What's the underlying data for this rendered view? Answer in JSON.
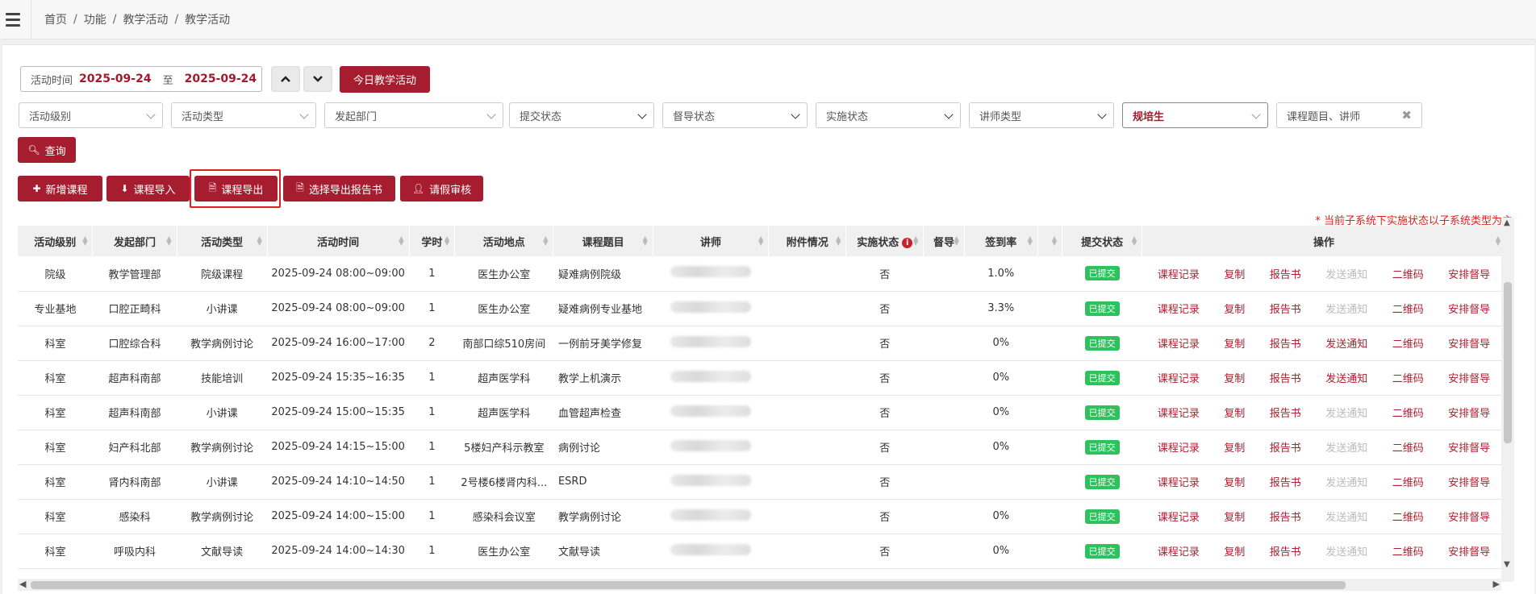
{
  "breadcrumb": [
    "首页",
    "功能",
    "教学活动",
    "教学活动"
  ],
  "date_filter": {
    "label": "活动时间",
    "start": "2025-09-24",
    "to": "至",
    "end": "2025-09-24"
  },
  "today_button": "今日教学活动",
  "filters": [
    {
      "label": "活动级别",
      "style": "light"
    },
    {
      "label": "活动类型",
      "style": "light"
    },
    {
      "label": "发起部门",
      "style": "light"
    },
    {
      "label": "提交状态",
      "style": "dark"
    },
    {
      "label": "督导状态",
      "style": "dark"
    },
    {
      "label": "实施状态",
      "style": "dark"
    },
    {
      "label": "讲师类型",
      "style": "dark"
    },
    {
      "label": "规培生",
      "style": "red"
    }
  ],
  "search_placeholder": "课程题目、讲师",
  "query_button": "查询",
  "actions": {
    "add": "新增课程",
    "import": "课程导入",
    "export": "课程导出",
    "export_report": "选择导出报告书",
    "leave": "请假审核"
  },
  "notice": "* 当前子系统下实施状态以子系统类型为主",
  "columns": [
    "活动级别",
    "发起部门",
    "活动类型",
    "活动时间",
    "学时",
    "活动地点",
    "课程题目",
    "讲师",
    "附件情况",
    "实施状态",
    "督导",
    "签到率",
    "",
    "提交状态",
    "操作"
  ],
  "rows": [
    {
      "level": "院级",
      "dept": "教学管理部",
      "type": "院级课程",
      "time": "2025-09-24  08:00~09:00",
      "hours": "1",
      "place": "医生办公室",
      "topic": "疑难病例院级",
      "impl": "否",
      "rate": "1.0%",
      "status": "已提交",
      "notify_active": false
    },
    {
      "level": "专业基地",
      "dept": "口腔正畸科",
      "type": "小讲课",
      "time": "2025-09-24  08:00~09:00",
      "hours": "1",
      "place": "医生办公室",
      "topic": "疑难病例专业基地",
      "impl": "否",
      "rate": "3.3%",
      "status": "已提交",
      "notify_active": false
    },
    {
      "level": "科室",
      "dept": "口腔综合科",
      "type": "教学病例讨论",
      "time": "2025-09-24  16:00~17:00",
      "hours": "2",
      "place": "南部口综510房间",
      "topic": "一例前牙美学修复",
      "impl": "否",
      "rate": "0%",
      "status": "已提交",
      "notify_active": true
    },
    {
      "level": "科室",
      "dept": "超声科南部",
      "type": "技能培训",
      "time": "2025-09-24  15:35~16:35",
      "hours": "1",
      "place": "超声医学科",
      "topic": "教学上机演示",
      "impl": "否",
      "rate": "0%",
      "status": "已提交",
      "notify_active": true
    },
    {
      "level": "科室",
      "dept": "超声科南部",
      "type": "小讲课",
      "time": "2025-09-24  15:00~15:35",
      "hours": "1",
      "place": "超声医学科",
      "topic": "血管超声检查",
      "impl": "否",
      "rate": "0%",
      "status": "已提交",
      "notify_active": false
    },
    {
      "level": "科室",
      "dept": "妇产科北部",
      "type": "教学病例讨论",
      "time": "2025-09-24  14:15~15:00",
      "hours": "1",
      "place": "5楼妇产科示教室",
      "topic": "病例讨论",
      "impl": "否",
      "rate": "0%",
      "status": "已提交",
      "notify_active": false
    },
    {
      "level": "科室",
      "dept": "肾内科南部",
      "type": "小讲课",
      "time": "2025-09-24  14:10~14:50",
      "hours": "1",
      "place": "2号楼6楼肾内科...",
      "topic": "ESRD",
      "impl": "否",
      "rate": "",
      "status": "已提交",
      "notify_active": false
    },
    {
      "level": "科室",
      "dept": "感染科",
      "type": "教学病例讨论",
      "time": "2025-09-24  14:00~15:00",
      "hours": "1",
      "place": "感染科会议室",
      "topic": "教学病例讨论",
      "impl": "否",
      "rate": "0%",
      "status": "已提交",
      "notify_active": false
    },
    {
      "level": "科室",
      "dept": "呼吸内科",
      "type": "文献导读",
      "time": "2025-09-24  14:00~14:30",
      "hours": "1",
      "place": "医生办公室",
      "topic": "文献导读",
      "impl": "否",
      "rate": "0%",
      "status": "已提交",
      "notify_active": false
    }
  ],
  "row_ops": {
    "record": "课程记录",
    "copy": "复制",
    "report": "报告书",
    "notify": "发送通知",
    "qr": "二维码",
    "supervise": "安排督导"
  },
  "colors": {
    "primary": "#a61d2f",
    "badge": "#2ec25d",
    "notice": "#e0211c"
  },
  "icons": {
    "menu": "hamburger-icon",
    "up": "chevron-up-icon",
    "down": "chevron-down-icon",
    "search": "search-icon",
    "add": "plus-icon",
    "import": "download-icon",
    "export": "file-export-icon",
    "leave": "user-icon",
    "info": "info-icon"
  }
}
